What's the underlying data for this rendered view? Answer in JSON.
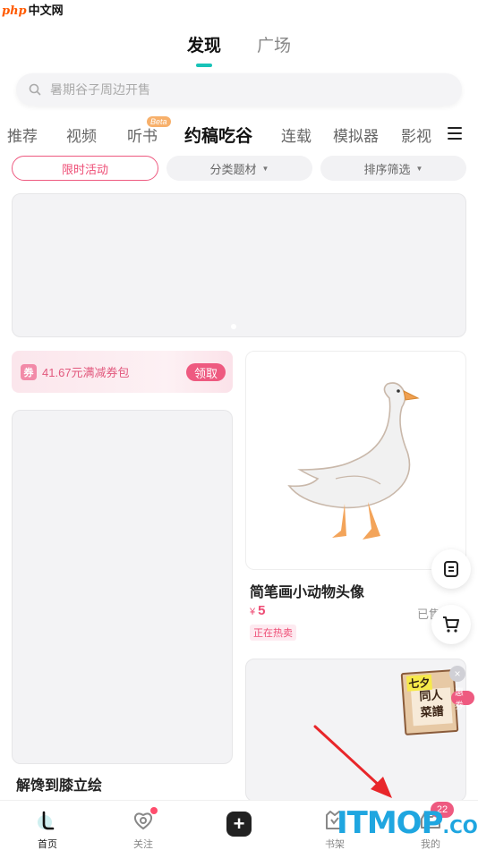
{
  "watermark_top": {
    "php": "php",
    "cn": "中文网"
  },
  "top_tabs": [
    {
      "label": "发现",
      "active": true
    },
    {
      "label": "广场",
      "active": false
    }
  ],
  "search": {
    "placeholder": "暑期谷子周边开售"
  },
  "categories": [
    {
      "label": "推荐"
    },
    {
      "label": "视频"
    },
    {
      "label": "听书",
      "badge": "Beta"
    },
    {
      "label": "约稿吃谷",
      "active": true
    },
    {
      "label": "连载"
    },
    {
      "label": "模拟器"
    },
    {
      "label": "影视"
    }
  ],
  "filters": {
    "active": "限时活动",
    "category": "分类题材",
    "sort": "排序筛选"
  },
  "coupon": {
    "icon_text": "券",
    "text": "41.67元满减券包",
    "button": "领取"
  },
  "cards": {
    "left_title": "解馋到膝立绘",
    "right_title": "简笔画小动物头像",
    "right_currency": "¥",
    "right_price": "5",
    "right_sold": "已售",
    "right_tag": "正在热卖"
  },
  "promo": {
    "corner_text": "七夕",
    "line1": "同人",
    "line2": "菜譜",
    "badge": "惠券",
    "close": "×"
  },
  "tabbar": [
    {
      "label": "首页",
      "active": true
    },
    {
      "label": "关注",
      "dot": true
    },
    {
      "label": ""
    },
    {
      "label": "书架"
    },
    {
      "label": "我的",
      "badge": "22"
    }
  ],
  "watermark_bottom": {
    "it": "ITMOP",
    "com": ".COM"
  },
  "colors": {
    "accent": "#18c3b8",
    "pink": "#ee5a80",
    "watermark": "#1fa6e0"
  }
}
